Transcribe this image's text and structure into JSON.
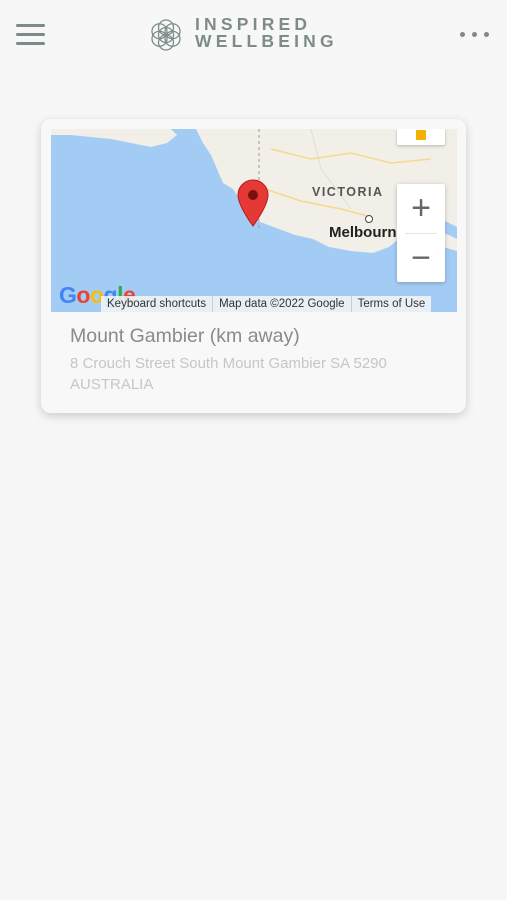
{
  "header": {
    "logo_line1": "INSPIRED",
    "logo_line2": "WELLBEING"
  },
  "location_card": {
    "title": "Mount Gambier (km away)",
    "address": "8 Crouch Street South Mount Gambier SA 5290 AUSTRALIA",
    "map": {
      "region_label": "VICTORIA",
      "city_label": "Melbourne",
      "zoom_in_label": "+",
      "zoom_out_label": "−",
      "provider_logo": "Google",
      "keyboard_shortcuts": "Keyboard shortcuts",
      "map_data": "Map data ©2022 Google",
      "terms": "Terms of Use",
      "marker_color": "#e53935",
      "water_color": "#a3ccf5",
      "land_color": "#f1efe8"
    }
  },
  "icons": {
    "menu": "hamburger-icon",
    "more": "more-dots-icon",
    "logo": "flower-of-life-icon",
    "marker": "map-pin-icon",
    "pegman": "street-view-pegman-icon"
  }
}
